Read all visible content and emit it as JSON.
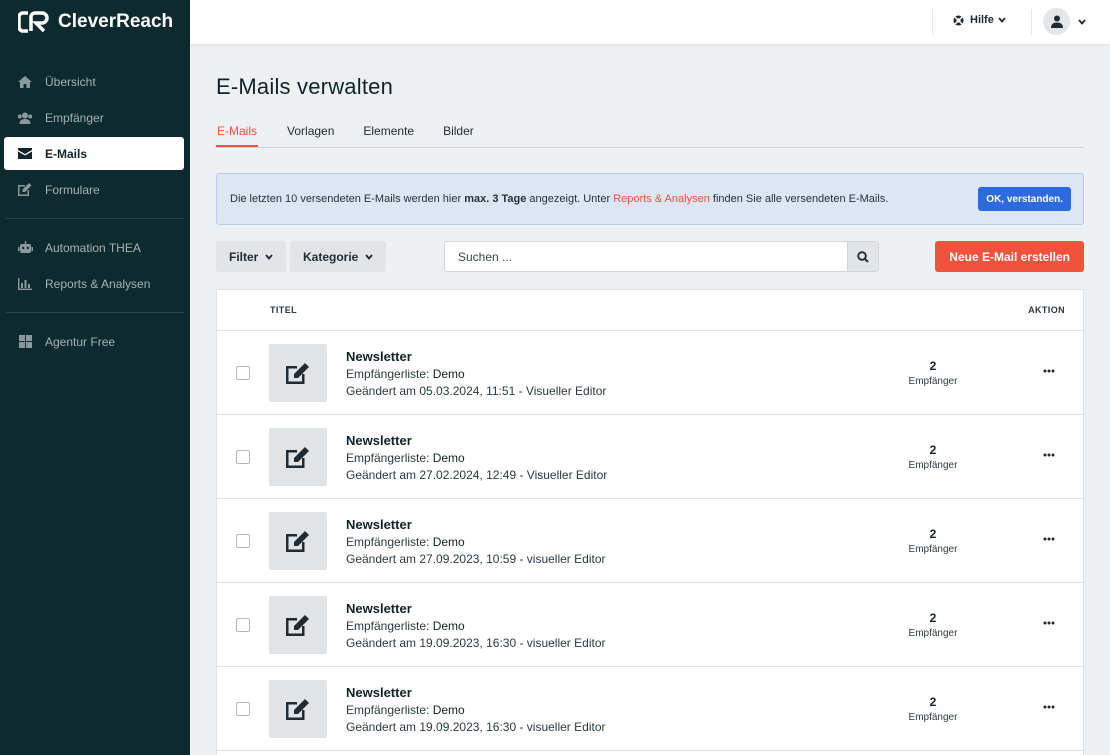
{
  "app": {
    "brand": "CleverReach"
  },
  "sidebar": {
    "items": [
      {
        "label": "Übersicht",
        "icon": "home-icon"
      },
      {
        "label": "Empfänger",
        "icon": "users-icon"
      },
      {
        "label": "E-Mails",
        "icon": "envelope-icon",
        "active": true
      },
      {
        "label": "Formulare",
        "icon": "edit-form-icon"
      },
      {
        "label": "Automation THEA",
        "icon": "robot-icon"
      },
      {
        "label": "Reports & Analysen",
        "icon": "bar-chart-icon"
      },
      {
        "label": "Agentur Free",
        "icon": "grid-icon"
      }
    ]
  },
  "header": {
    "help_label": "Hilfe"
  },
  "page": {
    "title": "E-Mails verwalten"
  },
  "tabs": [
    {
      "label": "E-Mails",
      "active": true
    },
    {
      "label": "Vorlagen"
    },
    {
      "label": "Elemente"
    },
    {
      "label": "Bilder"
    }
  ],
  "notice": {
    "text_1": "Die letzten 10 versendeten E-Mails werden hier ",
    "bold": "max. 3 Tage",
    "text_2": " angezeigt. Unter ",
    "link": "Reports & Analysen",
    "text_3": " finden Sie alle versendeten E-Mails.",
    "button": "OK, verstanden."
  },
  "toolbar": {
    "filter_label": "Filter",
    "category_label": "Kategorie",
    "search_placeholder": "Suchen ...",
    "new_email_label": "Neue E-Mail erstellen"
  },
  "table": {
    "col_title": "TITEL",
    "col_action": "AKTION",
    "rows": [
      {
        "title": "Newsletter",
        "list_label": "Empfängerliste:",
        "list": "Demo",
        "changed": "Geändert am 05.03.2024, 11:51 - Visueller Editor",
        "count": "2",
        "count_label": "Empfänger"
      },
      {
        "title": "Newsletter",
        "list_label": "Empfängerliste:",
        "list": "Demo",
        "changed": "Geändert am 27.02.2024, 12:49 - Visueller Editor",
        "count": "2",
        "count_label": "Empfänger"
      },
      {
        "title": "Newsletter",
        "list_label": "Empfängerliste:",
        "list": "Demo",
        "changed": "Geändert am 27.09.2023, 10:59 - visueller Editor",
        "count": "2",
        "count_label": "Empfänger"
      },
      {
        "title": "Newsletter",
        "list_label": "Empfängerliste:",
        "list": "Demo",
        "changed": "Geändert am 19.09.2023, 16:30 - visueller Editor",
        "count": "2",
        "count_label": "Empfänger"
      },
      {
        "title": "Newsletter",
        "list_label": "Empfängerliste:",
        "list": "Demo",
        "changed": "Geändert am 19.09.2023, 16:30 - visueller Editor",
        "count": "2",
        "count_label": "Empfänger"
      }
    ]
  },
  "colors": {
    "sidebar_bg": "#0d2a2e",
    "accent": "#f0533c",
    "info_bg": "#dce6f5",
    "primary_button": "#2d6ae2"
  }
}
